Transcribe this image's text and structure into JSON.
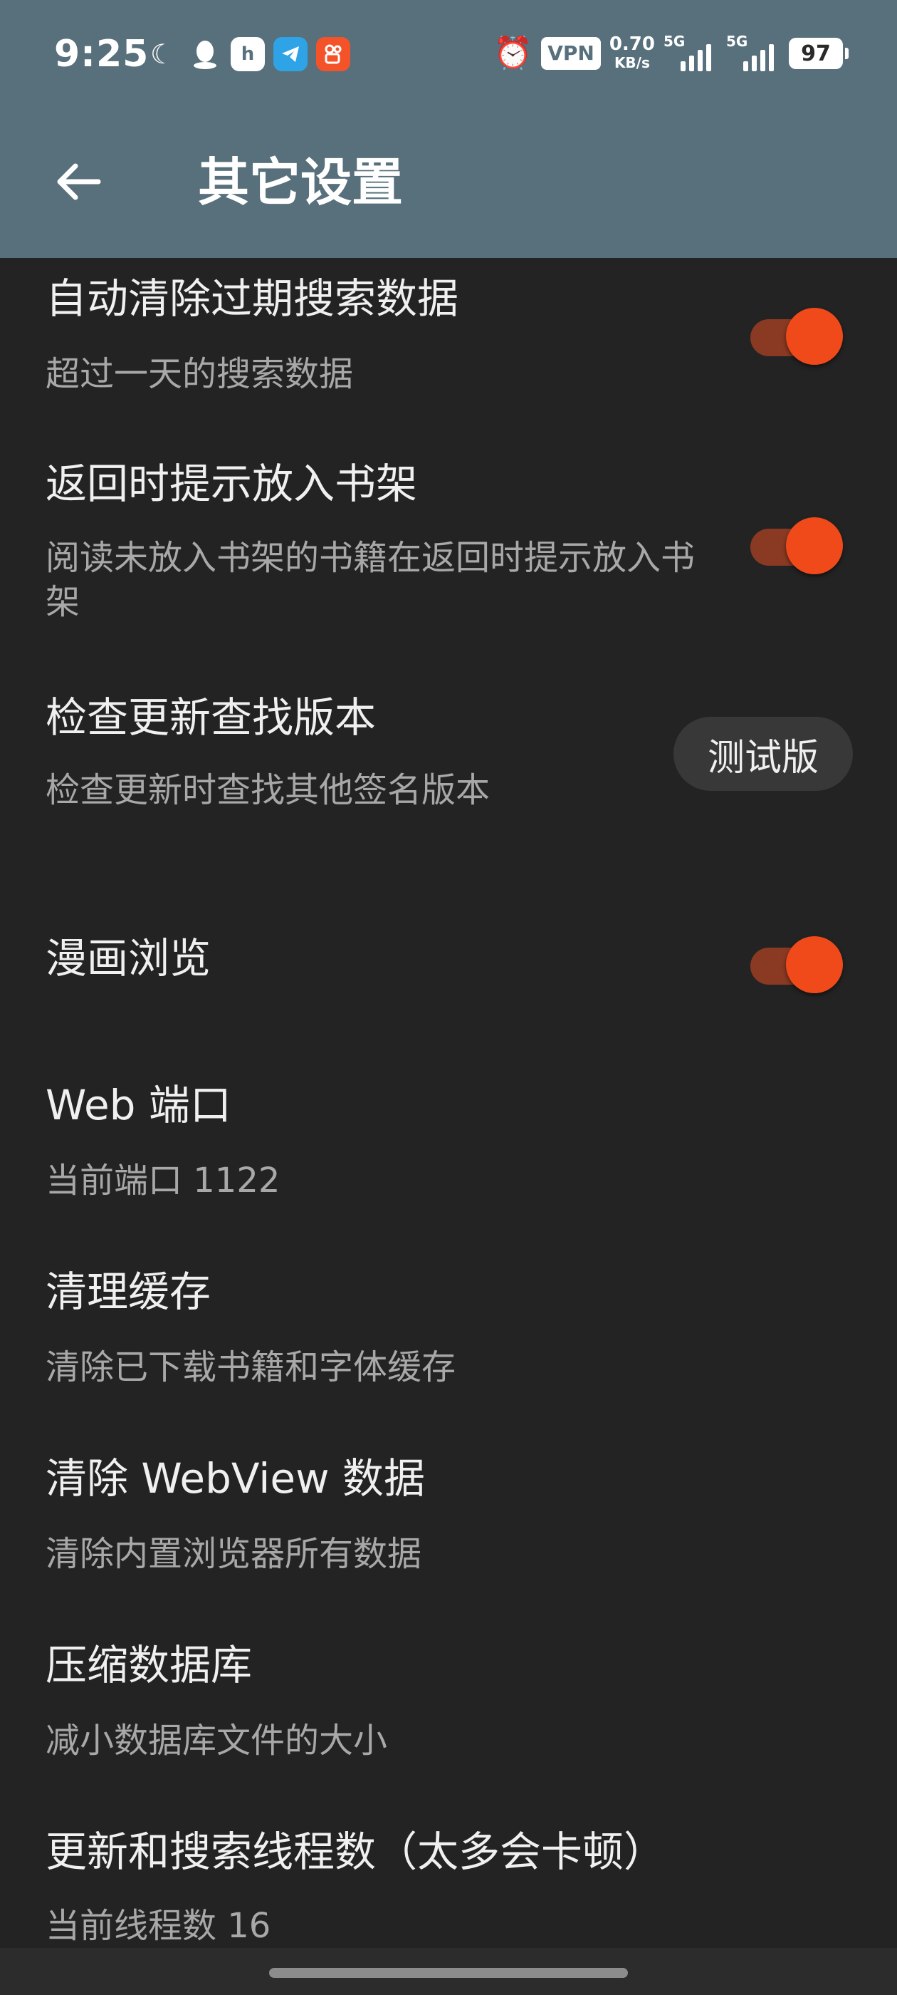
{
  "status_bar": {
    "time": "9:25",
    "notification_icons": [
      "moon-star-icon",
      "qq-icon",
      "app-h-icon",
      "telegram-icon",
      "kuaishou-icon"
    ],
    "vpn": "VPN",
    "net_speed": "0.70",
    "net_speed_unit": "KB/s",
    "signal_1_label": "5G",
    "signal_2_label": "5G",
    "battery": "97"
  },
  "header": {
    "title": "其它设置",
    "background": "#57707c"
  },
  "settings": [
    {
      "title": "自动清除过期搜索数据",
      "subtitle": "超过一天的搜索数据",
      "control": "toggle",
      "on": true
    },
    {
      "title": "返回时提示放入书架",
      "subtitle": "阅读未放入书架的书籍在返回时提示放入书架",
      "control": "toggle",
      "on": true
    },
    {
      "title": "检查更新查找版本",
      "subtitle": "检查更新时查找其他签名版本",
      "control": "button",
      "value": "测试版"
    },
    {
      "title": "漫画浏览",
      "subtitle": "",
      "control": "toggle",
      "on": true
    },
    {
      "title": "Web 端口",
      "subtitle": "当前端口 1122"
    },
    {
      "title": "清理缓存",
      "subtitle": "清除已下载书籍和字体缓存"
    },
    {
      "title": "清除 WebView 数据",
      "subtitle": "清除内置浏览器所有数据"
    },
    {
      "title": "压缩数据库",
      "subtitle": "减小数据库文件的大小"
    },
    {
      "title": "更新和搜索线程数（太多会卡顿）",
      "subtitle": "当前线程数 16"
    }
  ],
  "colors": {
    "accent": "#f04a1b",
    "track": "#8a3a22",
    "background": "#232323"
  }
}
